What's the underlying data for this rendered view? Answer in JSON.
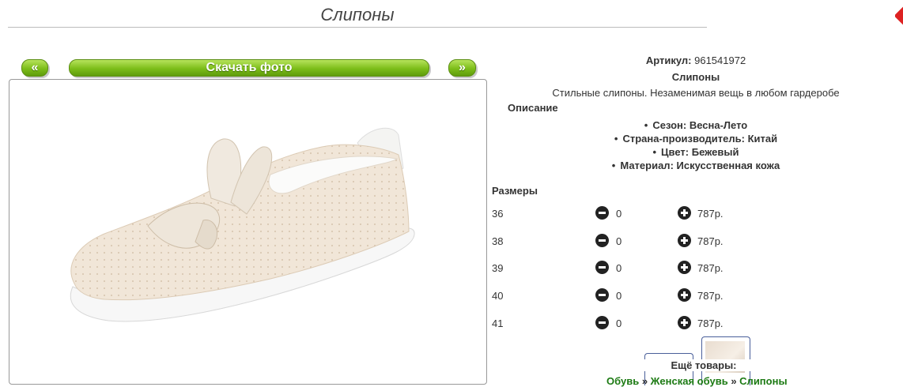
{
  "page_title": "Слипоны",
  "nav": {
    "prev_label": "«",
    "download_label": "Скачать фото",
    "next_label": "»"
  },
  "product": {
    "article_label": "Артикул:",
    "article_value": "961541972",
    "name": "Слипоны",
    "description": "Стильные слипоны. Незаменимая вещь в любом гардеробе",
    "properties_heading": "Описание",
    "properties": [
      "Сезон: Весна-Лето",
      "Страна-производитель: Китай",
      "Цвет: Бежевый",
      "Материал: Искусственная кожа"
    ]
  },
  "sizes": {
    "heading": "Размеры",
    "rows": [
      {
        "size": "36",
        "qty": "0",
        "price": "787р."
      },
      {
        "size": "38",
        "qty": "0",
        "price": "787р."
      },
      {
        "size": "39",
        "qty": "0",
        "price": "787р."
      },
      {
        "size": "40",
        "qty": "0",
        "price": "787р."
      },
      {
        "size": "41",
        "qty": "0",
        "price": "787р."
      }
    ]
  },
  "more_label": "Ещё товары:",
  "breadcrumbs": [
    "Обувь",
    "Женская обувь",
    "Слипоны"
  ],
  "breadcrumb_separator": "»",
  "colors": {
    "button_green": "#7cbd19",
    "link_green": "#1c7a13",
    "shoe": "#f1e6d8"
  }
}
